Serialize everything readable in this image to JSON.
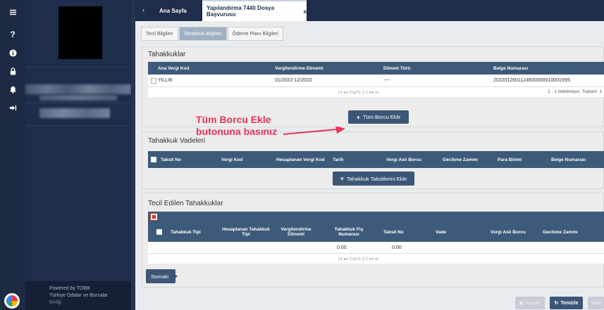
{
  "rail": {
    "icons": [
      "menu-icon",
      "help-icon",
      "info-icon",
      "lock-icon",
      "bell-icon",
      "logout-icon"
    ]
  },
  "sidebar": {
    "powered_line1": "Powered by TOBB",
    "powered_line2": "Türkiye Odalar ve Borsalar",
    "powered_line3": "Birliği"
  },
  "header": {
    "tab_home": "Ana Sayfa",
    "tab_active": "Yapılandırma 7440 Dosya Başvurusu",
    "tab_close": "x"
  },
  "subtabs": [
    "Tecil Bilgileri",
    "Tahakkuk Bilgileri",
    "Ödeme Planı Bilgileri"
  ],
  "tahakkuklar": {
    "title": "Tahakkuklar",
    "columns": [
      "Ana Vergi Kod",
      "Vergilendirme Dönemi",
      "Dönem Türü",
      "Belge Numarası"
    ],
    "rows": [
      {
        "ana_vergi_kod": "YILLIK",
        "donem": "01/2022-12/2022",
        "donem_turu": "----",
        "belge_no": "202201260112460000001000159S"
      }
    ],
    "pager_text": "Sayfa",
    "page_current": "1",
    "page_total": "/1",
    "status": "1 - 1 listeleniyor. Toplam: 1",
    "add_all_button": "Tüm Borcu Ekle"
  },
  "annotation": {
    "line1": "Tüm Borcu Ekle",
    "line2": "butonuna basınız",
    "color": "#e8335a"
  },
  "vadeler": {
    "title": "Tahakkuk Vadeleri",
    "columns": [
      "Taksit No",
      "Vergi Kod",
      "Hesaplanan Vergi Kod",
      "Tarih",
      "Vergi Aslı Borcu",
      "Gecikme Zammı",
      "Para Birimi",
      "Belge Numarası"
    ],
    "add_button": "Tahakkuk Taksitlerini Ekle"
  },
  "tecil": {
    "title": "Tecil Edilen Tahakkuklar",
    "columns": [
      "Tahakkuk Tipi",
      "Hesaplanan Tahakkuk Tipi",
      "Vergilendirme Dönemi",
      "Tahakkuk Fiş Numarası",
      "Taksit No",
      "Vade",
      "Vergi Aslı Borcu",
      "Gecikme Zammı"
    ],
    "row": {
      "fis_no": "0.00",
      "taksit_no": "0.00"
    },
    "pager_text": "Sayfa",
    "page_current": "1",
    "page_total": "/1"
  },
  "footer": {
    "next_button": "Sonraki",
    "save_button": "Kaydet",
    "clear_button": "Temizle",
    "extra_button": "Yapıl"
  },
  "colors": {
    "accent": "#3b5677",
    "table_header": "#3e5a7a",
    "sidebar": "#1e2d4a"
  }
}
